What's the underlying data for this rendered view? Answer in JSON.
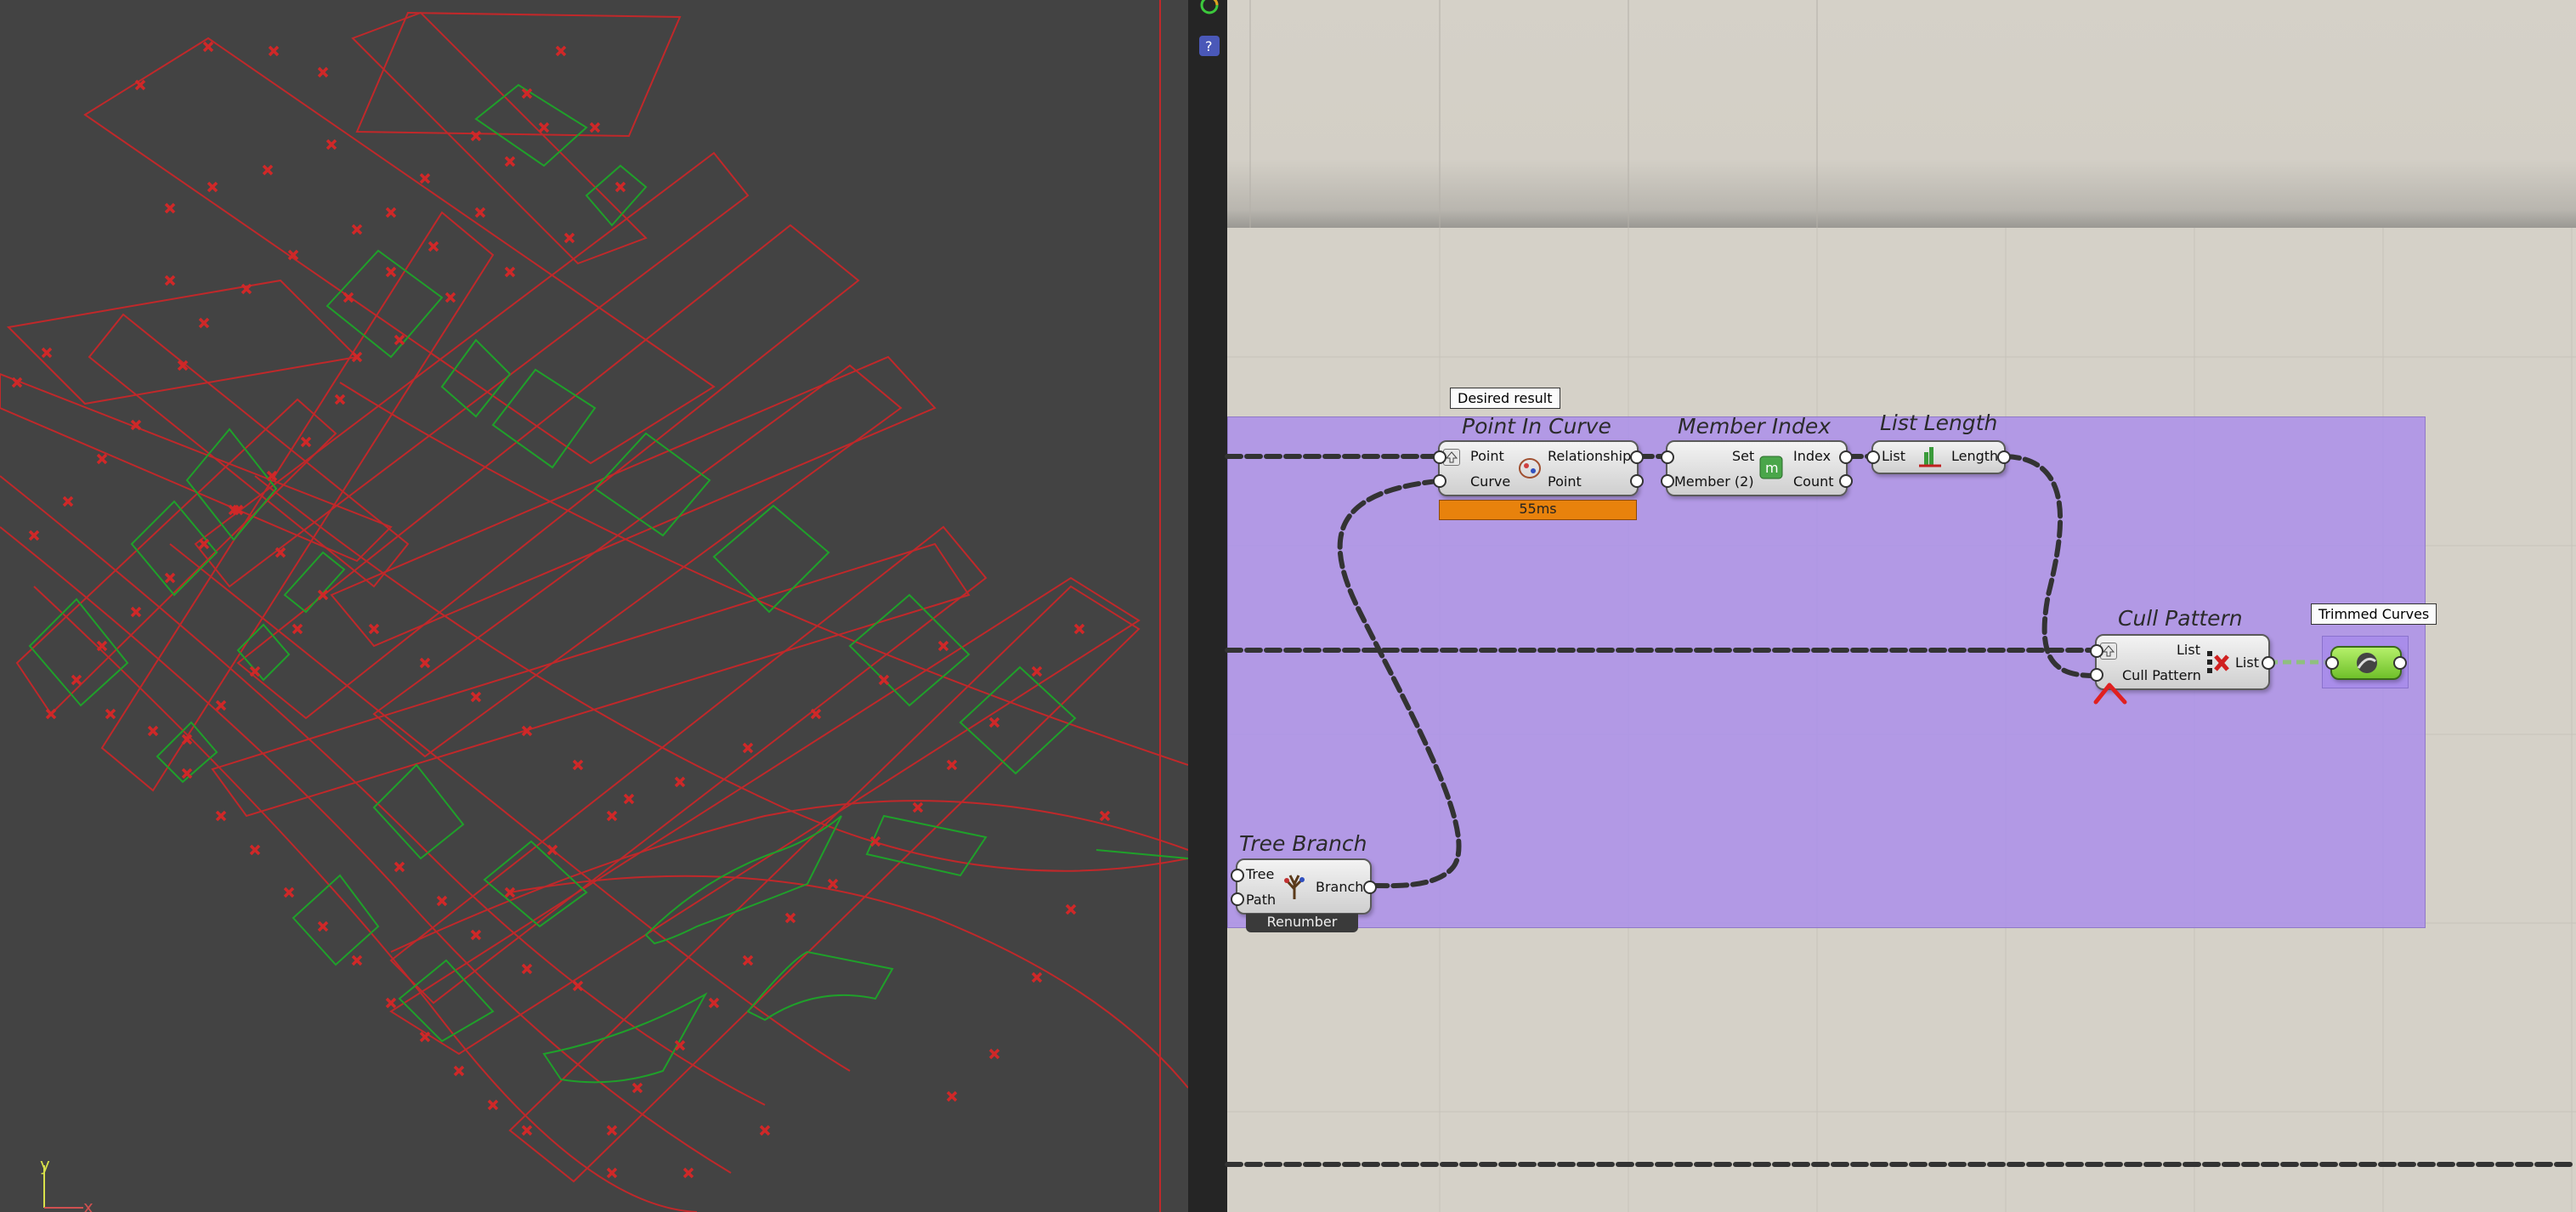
{
  "viewport": {
    "axis_y_label": "y",
    "axis_x_label": "x"
  },
  "canvas": {
    "tags": {
      "desired_result": "Desired result",
      "trimmed_curves": "Trimmed Curves"
    },
    "components": {
      "point_in_curve": {
        "title": "Point In Curve",
        "inputs": [
          "Point",
          "Curve"
        ],
        "outputs": [
          "Relationship",
          "Point"
        ],
        "timing": "55ms"
      },
      "member_index": {
        "title": "Member Index",
        "inputs": [
          "Set",
          "Member (2)"
        ],
        "outputs": [
          "Index",
          "Count"
        ]
      },
      "list_length": {
        "title": "List Length",
        "inputs": [
          "List"
        ],
        "outputs": [
          "Length"
        ]
      },
      "cull_pattern": {
        "title": "Cull Pattern",
        "inputs": [
          "List",
          "Cull Pattern"
        ],
        "outputs": [
          "List"
        ]
      },
      "tree_branch": {
        "title": "Tree Branch",
        "inputs": [
          "Tree",
          "Path"
        ],
        "outputs": [
          "Branch"
        ],
        "footer": "Renumber"
      }
    },
    "colors": {
      "group_fill": "#b39ae6",
      "timing_bar": "#e8820c",
      "wire": "#333333",
      "error_mark": "#e02020"
    }
  }
}
